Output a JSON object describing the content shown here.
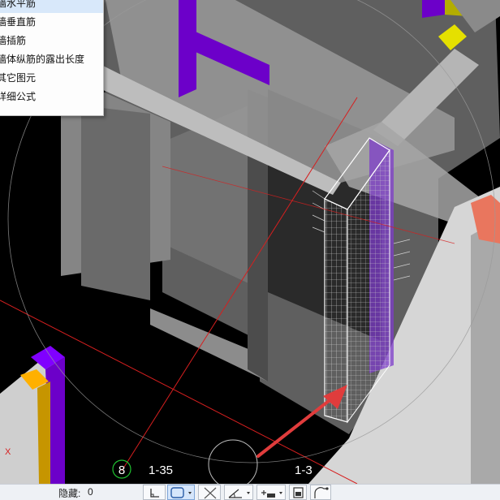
{
  "context_menu": {
    "items": [
      {
        "label": "墙水平筋"
      },
      {
        "label": "墙垂直筋"
      },
      {
        "label": "墙插筋"
      },
      {
        "label": "墙体纵筋的露出长度"
      },
      {
        "label": "其它图元"
      },
      {
        "label": "详细公式"
      }
    ]
  },
  "viewport": {
    "axis_number": "8",
    "axis_label_left": "1-35",
    "axis_label_right": "1-3",
    "axis_x_letter": "X"
  },
  "statusbar": {
    "hide_label": "隐藏:",
    "hide_count": "0",
    "tools": [
      {
        "icon": "orthogonal-icon"
      },
      {
        "icon": "rectangle-select-icon"
      },
      {
        "icon": "cross-select-icon"
      },
      {
        "icon": "angle-icon"
      },
      {
        "icon": "offset-input-icon"
      },
      {
        "icon": "display-settings-icon"
      },
      {
        "icon": "arc-icon"
      }
    ]
  },
  "colors": {
    "background": "#000000",
    "wall_gray": "#7d7d7d",
    "column_purple": "#6c00c9",
    "highlight_yellow": "#e5e000",
    "accent_orange": "#e9765e",
    "arrow_red": "#e03c3c",
    "axis_green": "#1fc02f"
  }
}
